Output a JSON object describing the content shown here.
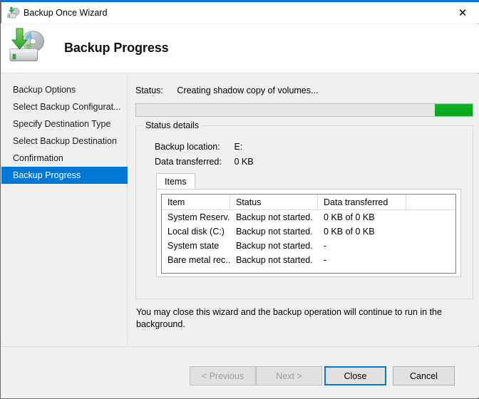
{
  "window": {
    "title": "Backup Once Wizard",
    "title_icon": "backup-wizard-icon",
    "close_icon": "✕",
    "accent_color": "#0078d7"
  },
  "header": {
    "title": "Backup Progress",
    "icon": "backup-disk-icon"
  },
  "sidebar": {
    "items": [
      {
        "label": "Backup Options",
        "selected": false
      },
      {
        "label": "Select Backup Configurat...",
        "selected": false
      },
      {
        "label": "Specify Destination Type",
        "selected": false
      },
      {
        "label": "Select Backup Destination",
        "selected": false
      },
      {
        "label": "Confirmation",
        "selected": false
      },
      {
        "label": "Backup Progress",
        "selected": true
      }
    ],
    "selected_color": "#0078d7"
  },
  "main": {
    "status_label": "Status:",
    "status_value": "Creating shadow copy of volumes...",
    "progress": {
      "style": "marquee",
      "chunk_color": "#0bab22",
      "track_color": "#e6e6e6"
    },
    "group": {
      "legend": "Status details",
      "backup_location_label": "Backup location:",
      "backup_location_value": "E:",
      "data_transferred_label": "Data transferred:",
      "data_transferred_value": "0 KB",
      "tabs": [
        {
          "label": "Items",
          "active": true
        }
      ],
      "table": {
        "columns": [
          "Item",
          "Status",
          "Data transferred",
          ""
        ],
        "rows": [
          [
            "System Reserv...",
            "Backup not started.",
            "0 KB of 0 KB",
            ""
          ],
          [
            "Local disk (C:)",
            "Backup not started.",
            "0 KB of 0 KB",
            ""
          ],
          [
            "System state",
            "Backup not started.",
            "-",
            ""
          ],
          [
            "Bare metal rec...",
            "Backup not started.",
            "-",
            ""
          ]
        ]
      }
    },
    "footnote": "You may close this wizard and the backup operation will continue to run in the background."
  },
  "buttons": {
    "previous": {
      "label": "< Previous",
      "disabled": true
    },
    "next": {
      "label": "Next >",
      "disabled": true
    },
    "close": {
      "label": "Close",
      "default": true
    },
    "cancel": {
      "label": "Cancel",
      "disabled": false
    }
  }
}
